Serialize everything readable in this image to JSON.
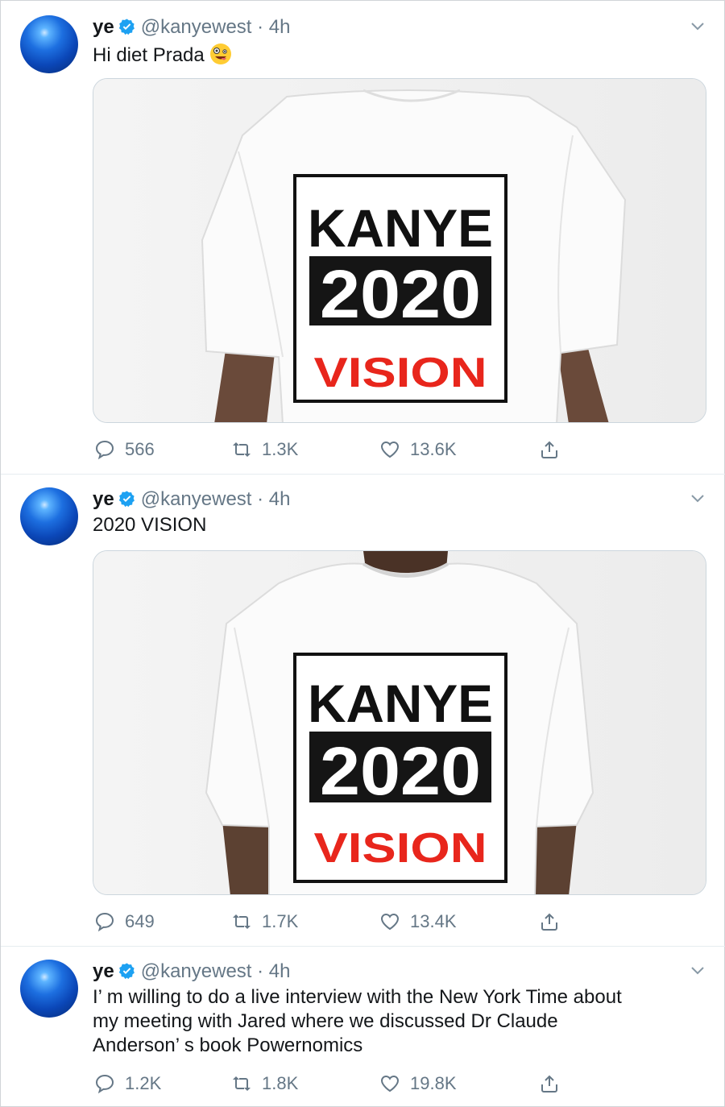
{
  "colors": {
    "accent": "#1da1f2",
    "muted": "#657786",
    "text": "#14171a",
    "vision_red": "#e8261c"
  },
  "tweets": [
    {
      "name": "ye",
      "handle": "@kanyewest · 4h",
      "text": "Hi diet Prada",
      "text_emoji": "zany-face-emoji",
      "media": {
        "line1": "KANYE",
        "line2": "2020",
        "line3": "VISION"
      },
      "replies": "566",
      "retweets": "1.3K",
      "likes": "13.6K"
    },
    {
      "name": "ye",
      "handle": "@kanyewest · 4h",
      "text": "2020 VISION",
      "media": {
        "line1": "KANYE",
        "line2": "2020",
        "line3": "VISION"
      },
      "replies": "649",
      "retweets": "1.7K",
      "likes": "13.4K"
    },
    {
      "name": "ye",
      "handle": "@kanyewest · 4h",
      "text_lines": [
        "I’ m willing to do a live interview with the New York Time about",
        "my meeting with Jared where we discussed Dr Claude",
        "Anderson’ s book Powernomics"
      ],
      "replies": "1.2K",
      "retweets": "1.8K",
      "likes": "19.8K"
    }
  ],
  "icons": {
    "verified": "verified-badge-icon",
    "caret": "chevron-down-icon",
    "reply": "reply-icon",
    "retweet": "retweet-icon",
    "like": "heart-icon",
    "share": "share-icon"
  }
}
